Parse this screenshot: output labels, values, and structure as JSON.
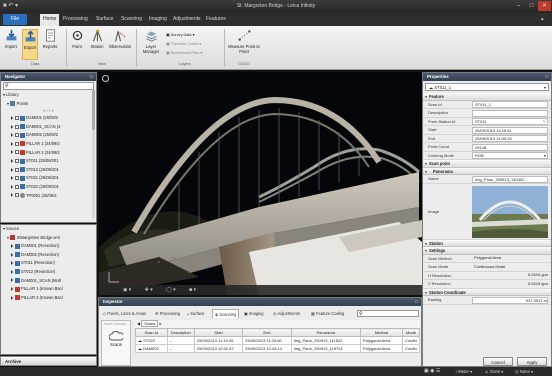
{
  "window": {
    "title": "St. Margreten Bridge - Leica Infinity"
  },
  "menu": {
    "file": "File",
    "home": "Home",
    "processing": "Processing",
    "surface": "Surface",
    "scanning": "Scanning",
    "imaging": "Imaging",
    "adjustments": "Adjustments",
    "features": "Features"
  },
  "ribbon": {
    "import": "Import",
    "export": "Export",
    "reports": "Reports",
    "group_data": "Data",
    "point": "Point",
    "station": "Station",
    "observation": "Observation",
    "group_new": "New",
    "layer_manager": "Layer Manager",
    "survey_data": "Survey Data",
    "thematic_codes": "Thematic Codes",
    "referenced_files": "Referenced Files",
    "group_layers": "Layers",
    "measure": "Measure Point to Point",
    "group_cogo": "COGO"
  },
  "navigator": {
    "title": "Navigator",
    "search_placeholder": "",
    "library": "Library",
    "points": "Points",
    "items": [
      "DAM001 (25/09/2",
      "DAM001_SCAN (2",
      "DAM002 (25/09/2",
      "PILLAR 1 (24/09/2",
      "PILLAR 2 (24/09/2",
      "ST011 (25/09/201",
      "ST012 (25/09/201",
      "ST021 (25/09/201",
      "ST022 (25/09/201",
      "TP0001 (25/09/2"
    ],
    "source": "Source",
    "source_root": "StMargreten Bridge.xml",
    "source_items": [
      "DAM001 (Resection)",
      "DAM002 (Resection)",
      "ST011 (Resection)",
      "ST012 (Resection)",
      "DAM001_SCAN (Mult",
      "PILLAR 1 (Known Bacl",
      "PILLAR 2 (Known Bacl"
    ],
    "archive": "Archive"
  },
  "inspector": {
    "title": "Inspector",
    "tabs": [
      "Points, Lines & Areas",
      "Processing",
      "Surface",
      "Scanning",
      "Imaging",
      "Adjustments",
      "Feature Coding"
    ],
    "scan_groups": "Scan Groups",
    "scans": "Scans",
    "breadcrumb": "Scans",
    "columns": [
      "Scan Id",
      "Description",
      "Start",
      "End",
      "Panorama",
      "Method",
      "Mode"
    ],
    "rows": [
      [
        "ST022",
        "–",
        "25/09/2013 11:19:26",
        "25/09/2013 11:33:50",
        "Img_Pano_250913_111522",
        "Polygonal Area",
        "Contin"
      ],
      [
        "DAM002",
        "–",
        "25/09/2013 12:02:47",
        "25/09/2013 12:43:14",
        "Img_Pano_250913_115701",
        "Polygonal Area",
        "Contin"
      ]
    ]
  },
  "properties": {
    "title": "Properties",
    "selected": "ST011_1",
    "feature": "Feature",
    "fields": [
      {
        "k": "Scan Id",
        "v": "ST011_1"
      },
      {
        "k": "Description",
        "v": ""
      },
      {
        "k": "From Station Id",
        "v": "ST011"
      },
      {
        "k": "Start",
        "v": "25/09/2013 14:15:51"
      },
      {
        "k": "End",
        "v": "25/09/2013 14:39:33"
      },
      {
        "k": "Point Count",
        "v": "29148"
      },
      {
        "k": "Coloring Mode",
        "v": "RGB"
      }
    ],
    "scan_point": "Scan point",
    "panorama": "Panorama",
    "name_label": "Name",
    "name_value": "Img_Pano_250913_140402",
    "image_label": "Image",
    "station": "Station",
    "settings": "Settings",
    "settings_fields": [
      {
        "k": "Scan Method",
        "v": "Polygonal Area"
      },
      {
        "k": "Scan Mode",
        "v": "Continuous Mode"
      },
      {
        "k": "H Resolution",
        "v": "0.0419 gon"
      },
      {
        "k": "V Resolution",
        "v": "0.0419 gon"
      }
    ],
    "station_coordinate": "Station Coordinate",
    "easting_label": "Easting",
    "easting_value": "937.9512 m",
    "cancel": "Cancel",
    "apply": "Apply"
  },
  "statusbar": {
    "meter": "Meter",
    "gons": "Gons",
    "none": "None"
  },
  "colors": {
    "accent": "#2b70c0",
    "panel_header": "#3d4b5d",
    "error": "#d23a2a"
  }
}
